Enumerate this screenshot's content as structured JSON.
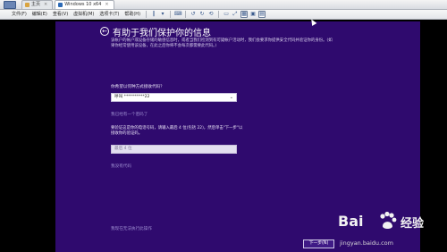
{
  "host": {
    "tabs": [
      {
        "label": "主页",
        "active": false
      },
      {
        "label": "Windows 10 x64",
        "active": true
      }
    ],
    "menu": [
      "文件(F)",
      "编辑(E)",
      "查看(V)",
      "虚拟机(M)",
      "选项卡(T)",
      "帮助(H)"
    ]
  },
  "guest": {
    "title": "有助于我们保护你的信息",
    "description": "该帐户的帐户或设备存储的敏感信息时，或者当我们检测到有可疑帐户活动时，我们会要求你提供安全代码并验证你的身份。(如果你经常使用该设备，在此之后你将不会每次都需要此代码。)",
    "receive_label": "你希望以何种方式接收代码？",
    "select_value": "呼叫 **********22",
    "code_link": "我已经有一个密码了",
    "alt_link": "你收到一个自动呼叫来查询代码。",
    "step_text": "要验证这是你的电话号码，请输入最后 4 位(包括 22)，然后单击\"下一步\"以接收你的验证码。",
    "input_placeholder": "最后 4 位",
    "resend_link": "我没有代码",
    "cannot_link": "我现在无法执行此操作",
    "next_label": "下一步(N)"
  },
  "watermark": {
    "brand": "Bai",
    "brand2": "经验",
    "url": "jingyan.baidu.com"
  }
}
